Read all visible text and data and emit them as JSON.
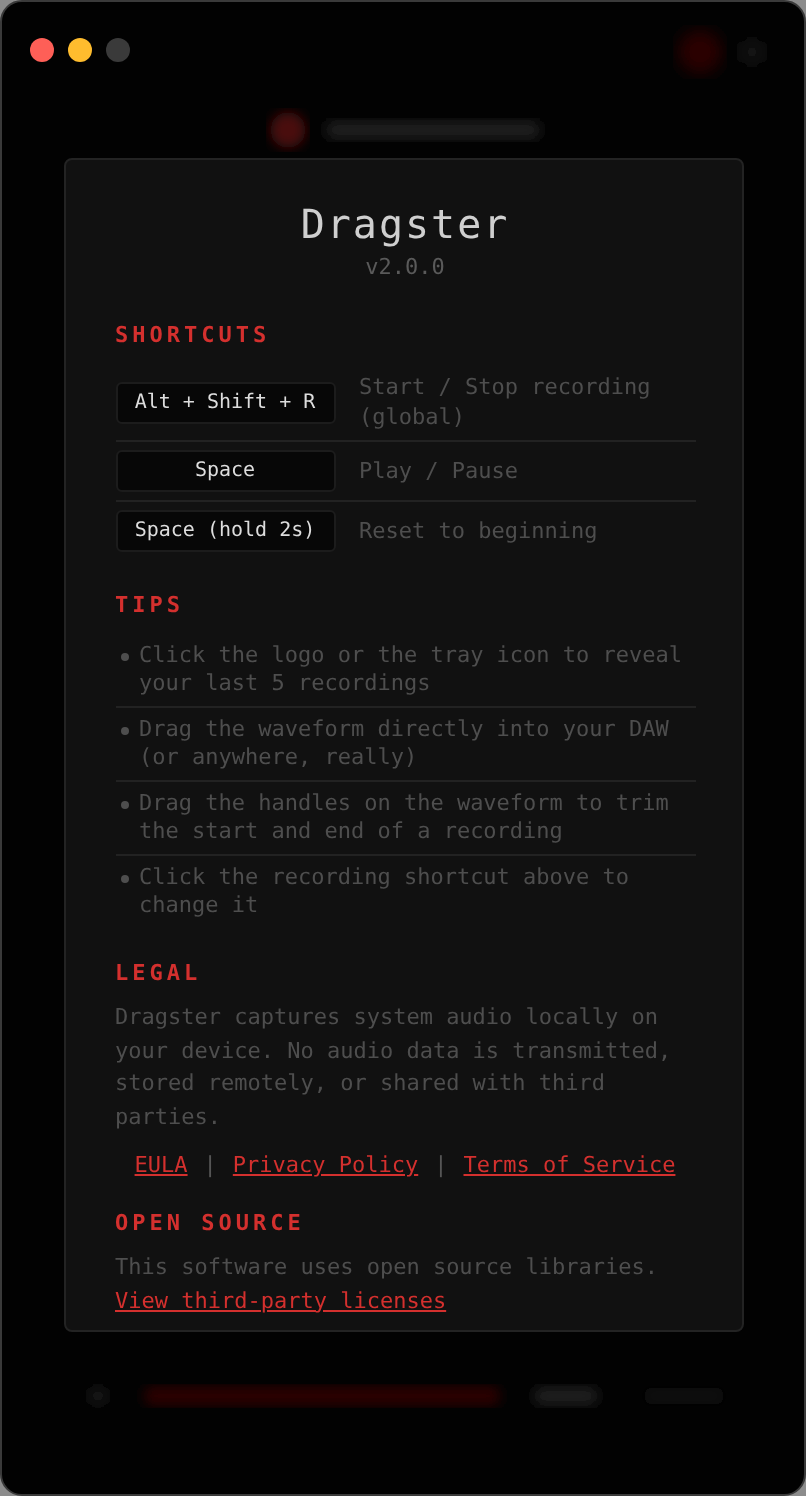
{
  "window": {
    "controls": [
      {
        "color": "#fe5f57"
      },
      {
        "color": "#febc2e"
      },
      {
        "color": "#3a3a3a"
      }
    ]
  },
  "about": {
    "title": "Dragster",
    "version": "v2.0.0",
    "shortcuts": {
      "heading": "SHORTCUTS",
      "items": [
        {
          "keys": "Alt + Shift + R",
          "action": "Start / Stop recording (global)"
        },
        {
          "keys": "Space",
          "action": "Play / Pause"
        },
        {
          "keys": "Space (hold 2s)",
          "action": "Reset to beginning"
        }
      ]
    },
    "tips": {
      "heading": "TIPS",
      "items": [
        "Click the logo or the tray icon to reveal your last 5 recordings",
        "Drag the waveform directly into your DAW (or anywhere, really)",
        "Drag the handles on the waveform to trim the start and end of a recording",
        "Click the recording shortcut above to change it"
      ]
    },
    "legal": {
      "heading": "LEGAL",
      "text": "Dragster captures system audio locally on your device. No audio data is transmitted, stored remotely, or shared with third parties.",
      "links": [
        "EULA",
        "Privacy Policy",
        "Terms of Service"
      ],
      "separator": "|"
    },
    "open_source": {
      "heading": "OPEN SOURCE",
      "text": "This software uses open source libraries.",
      "link": "View third-party licenses"
    }
  }
}
